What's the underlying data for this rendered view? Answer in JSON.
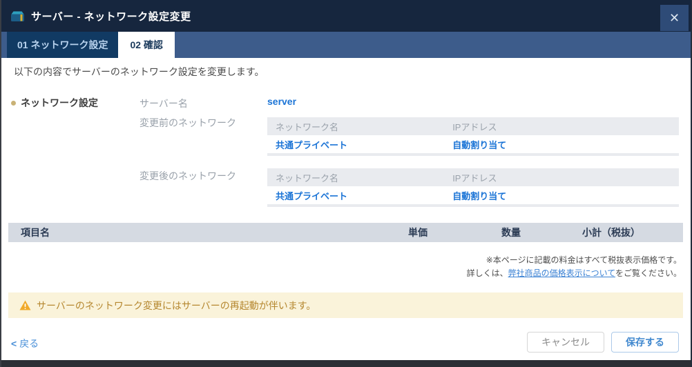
{
  "header": {
    "title": "サーバー - ネットワーク設定変更",
    "close_glyph": "✕"
  },
  "tabs": [
    {
      "label": "01 ネットワーク設定",
      "active": false
    },
    {
      "label": "02 確認",
      "active": true
    }
  ],
  "intro": "以下の内容でサーバーのネットワーク設定を変更します。",
  "section": {
    "title": "ネットワーク設定",
    "fields": [
      {
        "label": "サーバー名",
        "value": "server"
      },
      {
        "label": "変更前のネットワーク",
        "table": {
          "headers": [
            "ネットワーク名",
            "IPアドレス"
          ],
          "rows": [
            [
              "共通プライベート",
              "自動割り当て"
            ]
          ]
        }
      },
      {
        "label": "変更後のネットワーク",
        "table": {
          "headers": [
            "ネットワーク名",
            "IPアドレス"
          ],
          "rows": [
            [
              "共通プライベート",
              "自動割り当て"
            ]
          ]
        }
      }
    ]
  },
  "pricing": {
    "headers": [
      "項目名",
      "単価",
      "数量",
      "小計（税抜）"
    ],
    "rows": []
  },
  "notes": {
    "line1": "※本ページに記載の料金はすべて税抜表示価格です。",
    "line2_prefix": "詳しくは、",
    "line2_link": "弊社商品の価格表示について",
    "line2_suffix": "をご覧ください。"
  },
  "warning": {
    "text": "サーバーのネットワーク変更にはサーバーの再起動が伴います。"
  },
  "footer": {
    "back_chevron": "<",
    "back_label": "戻る",
    "cancel_label": "キャンセル",
    "save_label": "保存する"
  },
  "colors": {
    "header_bg": "#16263e",
    "tabbar_bg": "#3d5c8b",
    "tab_inactive_bg": "#113a63",
    "accent_blue": "#1b74d6",
    "pricing_header_bg": "#d5dae2",
    "warning_bg": "#faf3da",
    "warning_text": "#b5872f",
    "warning_icon": "#f0a929",
    "bottom_bar": "#2b2f35"
  }
}
